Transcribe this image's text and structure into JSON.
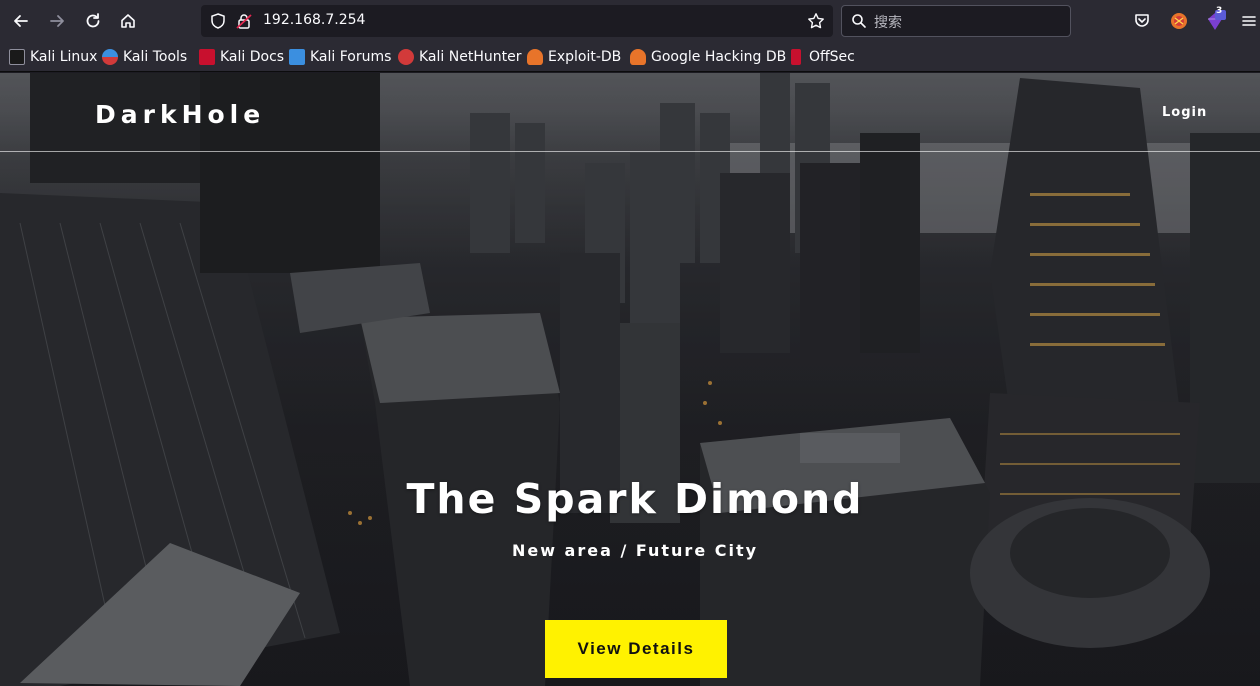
{
  "browser": {
    "url": "192.168.7.254",
    "search_placeholder": "搜索",
    "extension_badge": "3",
    "bookmarks": [
      {
        "label": "Kali Linux",
        "color": "#2f7fd8"
      },
      {
        "label": "Kali Tools",
        "color": "#d23a3a"
      },
      {
        "label": "Kali Docs",
        "color": "#c8102e"
      },
      {
        "label": "Kali Forums",
        "color": "#3b8fe0"
      },
      {
        "label": "Kali NetHunter",
        "color": "#d23a3a"
      },
      {
        "label": "Exploit-DB",
        "color": "#e8742a"
      },
      {
        "label": "Google Hacking DB",
        "color": "#e8742a"
      },
      {
        "label": "OffSec",
        "color": "#c8102e"
      }
    ]
  },
  "site": {
    "brand": "DarkHole",
    "nav_login": "Login",
    "hero_title": "The Spark Dimond",
    "hero_subtitle": "New area / Future City",
    "cta_label": "View Details",
    "cta_color": "#fff200"
  }
}
